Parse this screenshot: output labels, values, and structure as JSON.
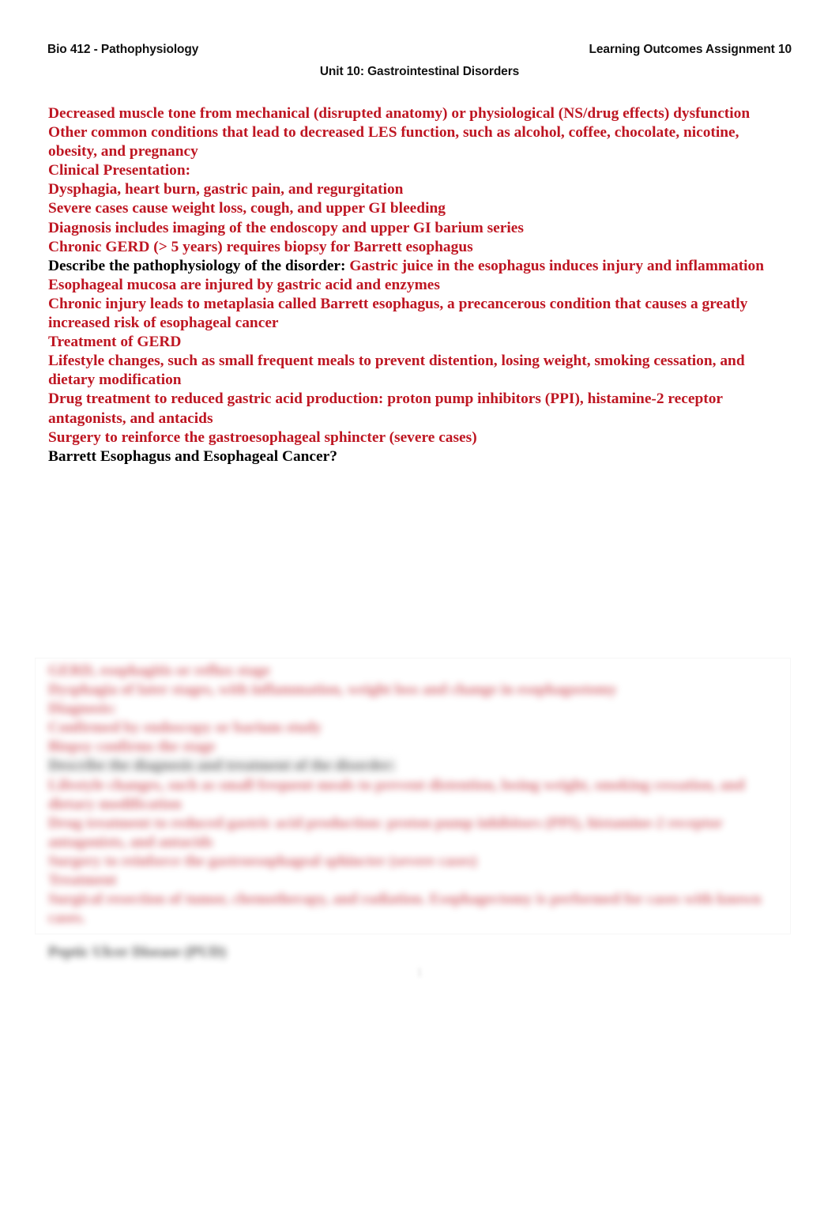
{
  "header": {
    "left": "Bio 412 - Pathophysiology",
    "right": "Learning Outcomes Assignment 10",
    "center": "Unit 10: Gastrointestinal Disorders"
  },
  "body": {
    "lines": [
      {
        "text": "Decreased muscle tone from mechanical (disrupted anatomy) or physiological (NS/drug effects) dysfunction",
        "color": "red"
      },
      {
        "text": "Other common conditions that lead to decreased LES function, such as alcohol, coffee, chocolate, nicotine, obesity, and pregnancy",
        "color": "red"
      },
      {
        "text": "Clinical Presentation:",
        "color": "red"
      },
      {
        "text": "Dysphagia, heart burn, gastric pain, and regurgitation",
        "color": "red"
      },
      {
        "text": "Severe cases cause weight loss, cough, and upper GI bleeding",
        "color": "red"
      },
      {
        "text": "Diagnosis includes imaging of the endoscopy and upper GI barium series",
        "color": "red"
      },
      {
        "text": "Chronic GERD (> 5 years) requires biopsy for Barrett esophagus",
        "color": "red"
      },
      {
        "lead": "Describe the pathophysiology of the disorder: ",
        "text": "Gastric juice in the esophagus induces injury and inflammation",
        "color": "mixed"
      },
      {
        "text": "Esophageal mucosa are injured by gastric acid and enzymes",
        "color": "red"
      },
      {
        "text": "Chronic injury leads to metaplasia called Barrett esophagus, a precancerous condition that causes a greatly increased risk of esophageal cancer",
        "color": "red"
      },
      {
        "text": "Treatment of GERD",
        "color": "red"
      },
      {
        "text": "Lifestyle changes, such as small frequent meals to prevent distention, losing weight, smoking cessation, and dietary modification",
        "color": "red"
      },
      {
        "text": "Drug treatment to reduced gastric acid production: proton pump inhibitors (PPI), histamine-2 receptor antagonists, and antacids",
        "color": "red"
      },
      {
        "text": "Surgery to reinforce the gastroesophageal sphincter (severe cases)",
        "color": "red"
      },
      {
        "text": "Barrett Esophagus and Esophageal Cancer?",
        "color": "black"
      }
    ]
  },
  "blurred_section": {
    "note": "illegible blurred text block",
    "lines": [
      {
        "text": "GERD, esophagitis or reflux stage",
        "color": "red"
      },
      {
        "text": "Dysphagia of later stages, with inflammation, weight loss and change in esophagostomy",
        "color": "red"
      },
      {
        "text": "Diagnosis:",
        "color": "red"
      },
      {
        "text": "Confirmed by endoscopy or barium study",
        "color": "red"
      },
      {
        "text": "Biopsy confirms the stage",
        "color": "red"
      },
      {
        "text": "Describe the diagnosis and treatment of the disorder:",
        "color": "black"
      },
      {
        "text": "Lifestyle changes, such as small frequent meals to prevent distention, losing weight, smoking cessation, and dietary modification",
        "color": "red"
      },
      {
        "text": "Drug treatment to reduced gastric acid production: proton pump inhibitors (PPI), histamine-2 receptor antagonists, and antacids",
        "color": "red"
      },
      {
        "text": "Surgery to reinforce the gastroesophageal sphincter (severe cases)",
        "color": "red"
      },
      {
        "text": "Treatment",
        "color": "red"
      },
      {
        "text": "Surgical resection of tumor, chemotherapy, and radiation. Esophagectomy is performed for cases with known cases.",
        "color": "red"
      }
    ]
  },
  "blur_heading": {
    "text": "Peptic Ulcer Disease (PUD)"
  },
  "page_number": {
    "value": "1"
  },
  "colors": {
    "body_red": "#BE1622",
    "ink_black": "#000000",
    "page_background": "#FFFFFF"
  }
}
